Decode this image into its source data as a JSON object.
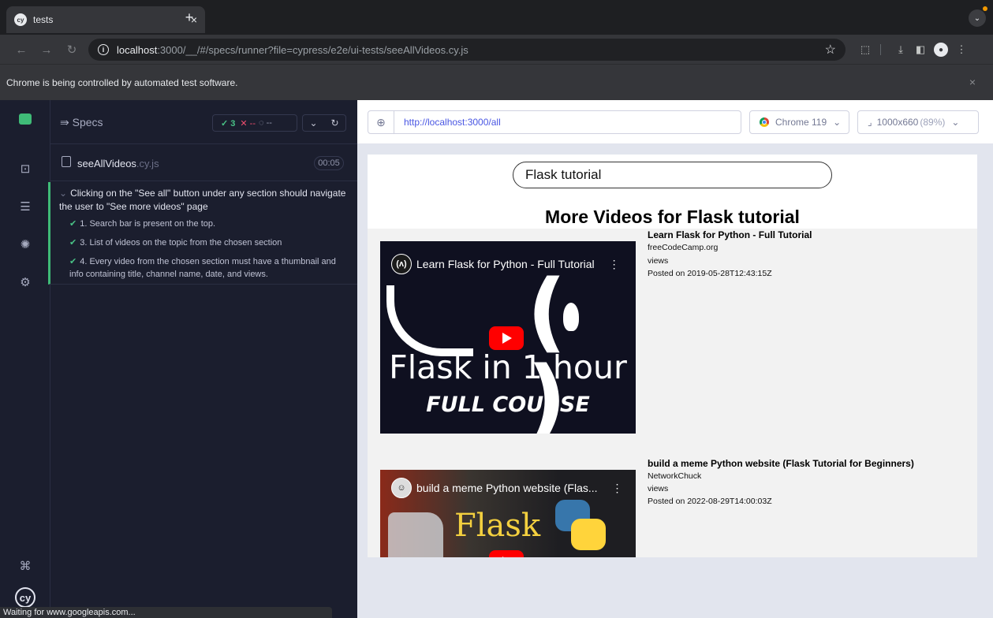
{
  "browser": {
    "tab_title": "tests",
    "tab_icon": "cy",
    "tab_close": "×",
    "new_tab": "+",
    "url_host": "localhost",
    "url_path": ":3000/__/#/specs/runner?file=cypress/e2e/ui-tests/seeAllVideos.cy.js",
    "infobar": "Chrome is being controlled by automated test software.",
    "infobar_close": "×",
    "status": "Waiting for www.googleapis.com..."
  },
  "cypress": {
    "specs_label": "Specs",
    "stats": {
      "passed": "✓ 3",
      "failed": "✕ --",
      "pending": "◌ --"
    },
    "spec_file": {
      "name": "seeAllVideos",
      "ext": ".cy.js",
      "duration": "00:05"
    },
    "suite_title": "Clicking on the \"See all\" button under any section should navigate the user to \"See more videos\" page",
    "tests": [
      "1. Search bar is present on the top.",
      "3. List of videos on the topic from the chosen section",
      "4. Every video from the chosen section must have a thumbnail and info containing title, channel name, date, and views."
    ],
    "logo": "cy"
  },
  "aut": {
    "url": "http://localhost:3000/all",
    "browser": "Chrome 119",
    "viewport": "1000x660",
    "viewport_pct": "(89%)"
  },
  "app": {
    "search_value": "Flask tutorial",
    "heading": "More Videos for Flask tutorial",
    "videos": [
      {
        "title": "Learn Flask for Python - Full Tutorial",
        "channel": "freeCodeCamp.org",
        "views": "views",
        "date": "Posted on 2019-05-28T12:43:15Z",
        "thumb_title": "Learn Flask for Python - Full Tutorial",
        "thumb_line1": "Flask in 1 hour",
        "thumb_line2": "FULL COURSE"
      },
      {
        "title": "build a meme Python website (Flask Tutorial for Beginners)",
        "channel": "NetworkChuck",
        "views": "views",
        "date": "Posted on 2022-08-29T14:00:03Z",
        "thumb_title": "build a meme Python website (Flas...",
        "thumb_line1": "Flask"
      }
    ]
  },
  "colors": {
    "pass": "#49c286",
    "fail": "#f04e6e",
    "accent": "#4956e3",
    "suite_bar": "#3fbb77"
  }
}
